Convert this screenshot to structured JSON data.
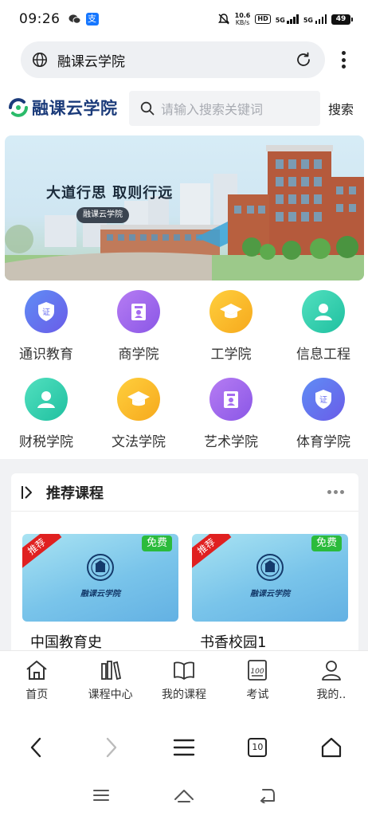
{
  "status_bar": {
    "time": "09:26",
    "alipay_glyph": "支",
    "net_speed_value": "10.6",
    "net_speed_unit": "KB/s",
    "hd_label": "HD",
    "signal1_label": "5G",
    "signal2_label": "5G",
    "battery": "49"
  },
  "browser": {
    "address_title": "融课云学院",
    "tabs_count": "10"
  },
  "header": {
    "logo_text": "融课云学院",
    "search_placeholder": "请输入搜索关键词",
    "search_button": "搜索"
  },
  "banner": {
    "slogan": "大道行思  取则行远",
    "tag": "融课云学院"
  },
  "categories": [
    {
      "label": "通识教育",
      "icon": "shield-cert-icon",
      "color": "#6a7ef0"
    },
    {
      "label": "商学院",
      "icon": "id-card-icon",
      "color": "#a56cf0"
    },
    {
      "label": "工学院",
      "icon": "graduation-cap-icon",
      "color": "#f8b92a"
    },
    {
      "label": "信息工程",
      "icon": "person-icon",
      "color": "#33cfae"
    },
    {
      "label": "财税学院",
      "icon": "person-icon",
      "color": "#33cfae"
    },
    {
      "label": "文法学院",
      "icon": "graduation-cap-icon",
      "color": "#f8b92a"
    },
    {
      "label": "艺术学院",
      "icon": "id-card-icon",
      "color": "#a56cf0"
    },
    {
      "label": "体育学院",
      "icon": "shield-cert-icon",
      "color": "#6a7ef0"
    }
  ],
  "section": {
    "title": "推荐课程"
  },
  "courses": [
    {
      "title": "中国教育史",
      "badge": "免费",
      "ribbon": "推荐",
      "brand": "融课云学院"
    },
    {
      "title": "书香校园1",
      "badge": "免费",
      "ribbon": "推荐",
      "brand": "融课云学院"
    }
  ],
  "tabbar": [
    {
      "label": "首页",
      "icon": "home-icon"
    },
    {
      "label": "课程中心",
      "icon": "books-icon"
    },
    {
      "label": "我的课程",
      "icon": "open-book-icon"
    },
    {
      "label": "考试",
      "icon": "exam-paper-icon"
    },
    {
      "label": "我的..",
      "icon": "user-icon"
    }
  ],
  "colors": {
    "brand_navy": "#1b3b7a",
    "free_badge": "#2bbb3c",
    "ribbon_red": "#e02020"
  }
}
